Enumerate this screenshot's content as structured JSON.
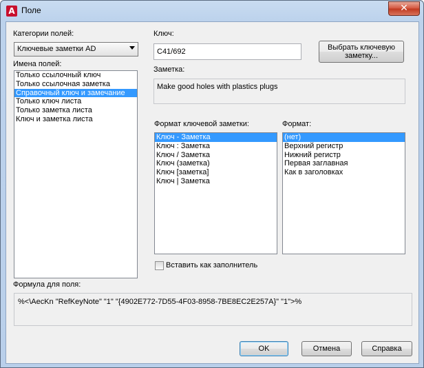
{
  "window": {
    "title": "Поле",
    "close_glyph": "✕",
    "app_glyph": "A"
  },
  "categories": {
    "label": "Категории полей:",
    "selected": "Ключевые заметки AD"
  },
  "field_names": {
    "label": "Имена полей:",
    "items": [
      {
        "text": "Только ссылочный ключ",
        "selected": false
      },
      {
        "text": "Только ссылочная заметка",
        "selected": false
      },
      {
        "text": "Справочный ключ и замечание",
        "selected": true
      },
      {
        "text": "Только ключ листа",
        "selected": false
      },
      {
        "text": "Только заметка листа",
        "selected": false
      },
      {
        "text": "Ключ и заметка листа",
        "selected": false
      }
    ]
  },
  "key": {
    "label": "Ключ:",
    "value": "C41/692"
  },
  "select_keynote_button": {
    "line1": "Выбрать ключевую",
    "line2": "заметку..."
  },
  "note": {
    "label": "Заметка:",
    "value": "Make good holes with plastics plugs"
  },
  "keynote_format": {
    "label": "Формат ключевой заметки:",
    "items": [
      {
        "text": "Ключ  - Заметка",
        "selected": true
      },
      {
        "text": "Ключ  : Заметка",
        "selected": false
      },
      {
        "text": "Ключ  / Заметка",
        "selected": false
      },
      {
        "text": "Ключ (заметка)",
        "selected": false
      },
      {
        "text": "Ключ [заметка]",
        "selected": false
      },
      {
        "text": "Ключ | Заметка",
        "selected": false
      }
    ]
  },
  "format": {
    "label": "Формат:",
    "items": [
      {
        "text": "(нет)",
        "selected": true
      },
      {
        "text": "Верхний регистр",
        "selected": false
      },
      {
        "text": "Нижний регистр",
        "selected": false
      },
      {
        "text": "Первая заглавная",
        "selected": false
      },
      {
        "text": "Как в заголовках",
        "selected": false
      }
    ]
  },
  "placeholder_checkbox": {
    "label": "Вставить как заполнитель",
    "checked": false
  },
  "formula": {
    "label": "Формула для поля:",
    "value": "%<\\AecKn \"RefKeyNote\" \"1\" \"{4902E772-7D55-4F03-8958-7BE8EC2E257A}\" \"1\">%"
  },
  "buttons": {
    "ok": "OK",
    "cancel": "Отмена",
    "help": "Справка"
  },
  "colors": {
    "selection": "#3399ff",
    "accent_red": "#c8102e"
  }
}
